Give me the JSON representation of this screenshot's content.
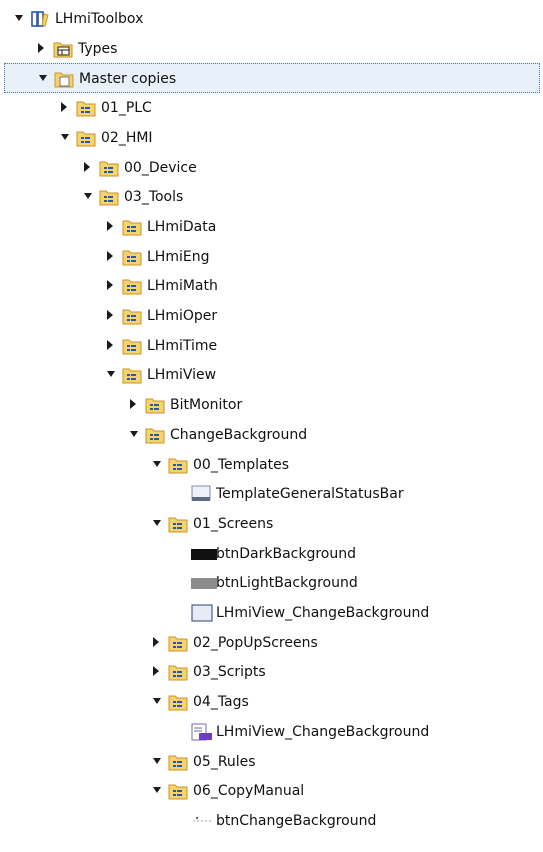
{
  "tree": [
    {
      "label": "LHmiToolbox",
      "depth": 0,
      "expanded": true,
      "icon": "library-icon"
    },
    {
      "label": "Types",
      "depth": 1,
      "expanded": false,
      "icon": "types-folder-icon"
    },
    {
      "label": "Master copies",
      "depth": 1,
      "expanded": true,
      "icon": "master-copies-folder-icon",
      "selected": true
    },
    {
      "label": "01_PLC",
      "depth": 2,
      "expanded": false,
      "icon": "folder-icon"
    },
    {
      "label": "02_HMI",
      "depth": 2,
      "expanded": true,
      "icon": "folder-icon"
    },
    {
      "label": "00_Device",
      "depth": 3,
      "expanded": false,
      "icon": "folder-icon"
    },
    {
      "label": "03_Tools",
      "depth": 3,
      "expanded": true,
      "icon": "folder-icon"
    },
    {
      "label": "LHmiData",
      "depth": 4,
      "expanded": false,
      "icon": "folder-icon"
    },
    {
      "label": "LHmiEng",
      "depth": 4,
      "expanded": false,
      "icon": "folder-icon"
    },
    {
      "label": "LHmiMath",
      "depth": 4,
      "expanded": false,
      "icon": "folder-icon"
    },
    {
      "label": "LHmiOper",
      "depth": 4,
      "expanded": false,
      "icon": "folder-icon"
    },
    {
      "label": "LHmiTime",
      "depth": 4,
      "expanded": false,
      "icon": "folder-icon"
    },
    {
      "label": "LHmiView",
      "depth": 4,
      "expanded": true,
      "icon": "folder-icon"
    },
    {
      "label": "BitMonitor",
      "depth": 5,
      "expanded": false,
      "icon": "folder-icon"
    },
    {
      "label": "ChangeBackground",
      "depth": 5,
      "expanded": true,
      "icon": "folder-icon"
    },
    {
      "label": "00_Templates",
      "depth": 6,
      "expanded": true,
      "icon": "folder-icon"
    },
    {
      "label": "TemplateGeneralStatusBar",
      "depth": 7,
      "icon": "template-screen-icon"
    },
    {
      "label": "01_Screens",
      "depth": 6,
      "expanded": true,
      "icon": "folder-icon"
    },
    {
      "label": "btnDarkBackground",
      "depth": 7,
      "icon": "dark-button-icon"
    },
    {
      "label": "btnLightBackground",
      "depth": 7,
      "icon": "grey-button-icon"
    },
    {
      "label": "LHmiView_ChangeBackground",
      "depth": 7,
      "icon": "screen-icon"
    },
    {
      "label": "02_PopUpScreens",
      "depth": 6,
      "expanded": false,
      "icon": "folder-icon"
    },
    {
      "label": "03_Scripts",
      "depth": 6,
      "expanded": false,
      "icon": "folder-icon"
    },
    {
      "label": "04_Tags",
      "depth": 6,
      "expanded": true,
      "icon": "folder-icon"
    },
    {
      "label": "LHmiView_ChangeBackground",
      "depth": 7,
      "icon": "tag-table-icon"
    },
    {
      "label": "05_Rules",
      "depth": 6,
      "expanded": true,
      "icon": "folder-icon"
    },
    {
      "label": "06_CopyManual",
      "depth": 6,
      "expanded": true,
      "icon": "folder-icon"
    },
    {
      "label": "btnChangeBackground",
      "depth": 7,
      "icon": "button-object-icon"
    }
  ],
  "colors": {
    "folder_fill": "#f6d36b",
    "folder_edge": "#c8932a",
    "folder_glyph": "#2a58a8",
    "selection_fill": "#e8f0f9",
    "selection_border": "#3c78c8"
  }
}
